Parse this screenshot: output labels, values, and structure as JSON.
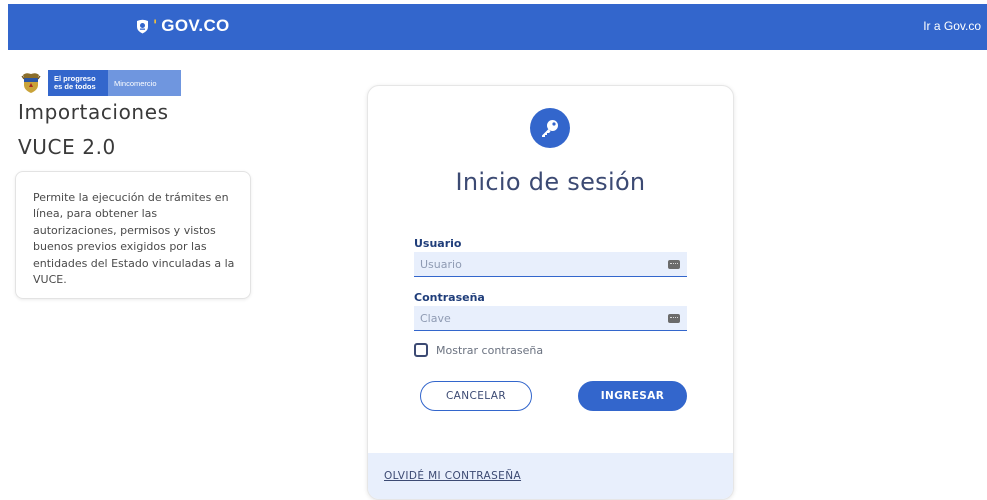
{
  "header": {
    "logo_text": "GOV.CO",
    "logo_separator": "'",
    "link_label": "Ir a Gov.co"
  },
  "brand": {
    "progreso_label": "El progreso es de todos",
    "ministry_label": "Mincomercio"
  },
  "app": {
    "title_line1": "Importaciones",
    "title_line2": "VUCE 2.0",
    "description": "Permite la ejecución de trámites en línea, para obtener las autorizaciones, permisos y vistos buenos previos exigidos por las entidades del Estado vinculadas a la VUCE."
  },
  "login": {
    "title": "Inicio de sesión",
    "username_label": "Usuario",
    "username_placeholder": "Usuario",
    "username_value": "",
    "password_label": "Contraseña",
    "password_placeholder": "Clave",
    "password_value": "",
    "show_password_label": "Mostrar contraseña",
    "show_password_checked": false,
    "cancel_label": "CANCELAR",
    "submit_label": "INGRESAR",
    "forgot_label": "OLVIDÉ MI CONTRASEÑA"
  },
  "colors": {
    "primary": "#3366cc",
    "input_bg": "#e8effc",
    "title_text": "#3c4a73"
  },
  "icons": {
    "header_logo": "colombia-seal-icon",
    "brand": "shield-icon",
    "login": "key-icon",
    "field": "keyboard-icon"
  }
}
